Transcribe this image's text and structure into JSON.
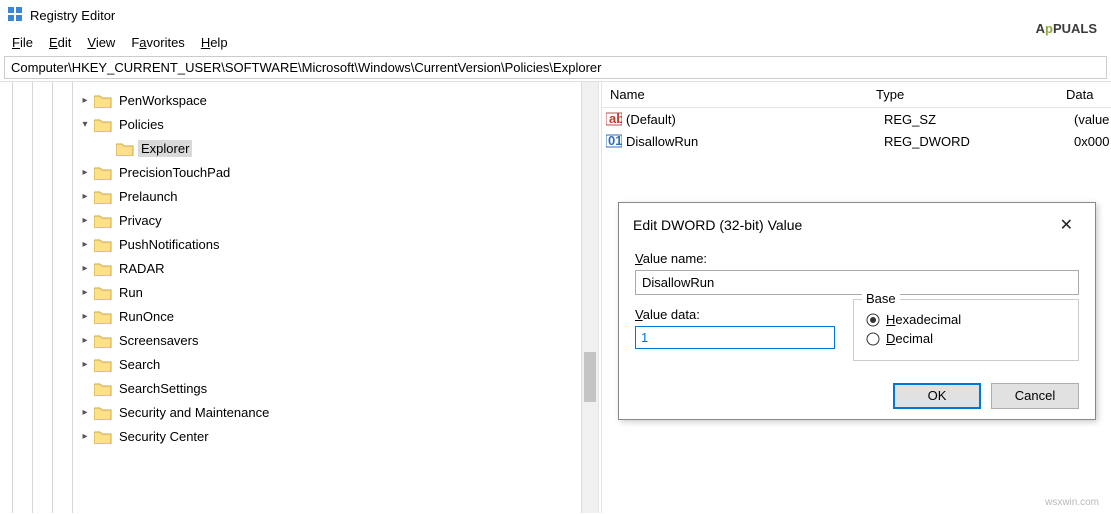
{
  "window": {
    "title": "Registry Editor"
  },
  "menus": [
    "File",
    "Edit",
    "View",
    "Favorites",
    "Help"
  ],
  "address": "Computer\\HKEY_CURRENT_USER\\SOFTWARE\\Microsoft\\Windows\\CurrentVersion\\Policies\\Explorer",
  "tree": [
    {
      "name": "PenWorkspace",
      "indent": 0,
      "toggle": "closed",
      "selected": false,
      "lead": true
    },
    {
      "name": "Policies",
      "indent": 0,
      "toggle": "open",
      "selected": false,
      "lead": true
    },
    {
      "name": "Explorer",
      "indent": 1,
      "toggle": "none",
      "selected": true,
      "lead": false
    },
    {
      "name": "PrecisionTouchPad",
      "indent": 0,
      "toggle": "closed",
      "selected": false,
      "lead": true
    },
    {
      "name": "Prelaunch",
      "indent": 0,
      "toggle": "closed",
      "selected": false,
      "lead": true
    },
    {
      "name": "Privacy",
      "indent": 0,
      "toggle": "closed",
      "selected": false,
      "lead": true
    },
    {
      "name": "PushNotifications",
      "indent": 0,
      "toggle": "closed",
      "selected": false,
      "lead": true
    },
    {
      "name": "RADAR",
      "indent": 0,
      "toggle": "closed",
      "selected": false,
      "lead": true
    },
    {
      "name": "Run",
      "indent": 0,
      "toggle": "closed",
      "selected": false,
      "lead": true
    },
    {
      "name": "RunOnce",
      "indent": 0,
      "toggle": "closed",
      "selected": false,
      "lead": true
    },
    {
      "name": "Screensavers",
      "indent": 0,
      "toggle": "closed",
      "selected": false,
      "lead": true
    },
    {
      "name": "Search",
      "indent": 0,
      "toggle": "closed",
      "selected": false,
      "lead": true
    },
    {
      "name": "SearchSettings",
      "indent": 0,
      "toggle": "none",
      "selected": false,
      "lead": true
    },
    {
      "name": "Security and Maintenance",
      "indent": 0,
      "toggle": "closed",
      "selected": false,
      "lead": true
    },
    {
      "name": "Security Center",
      "indent": 0,
      "toggle": "closed",
      "selected": false,
      "lead": true
    }
  ],
  "list": {
    "headers": {
      "name": "Name",
      "type": "Type",
      "data": "Data"
    },
    "rows": [
      {
        "icon": "string",
        "name": "(Default)",
        "type": "REG_SZ",
        "data": "(value"
      },
      {
        "icon": "dword",
        "name": "DisallowRun",
        "type": "REG_DWORD",
        "data": "0x000"
      }
    ]
  },
  "dialog": {
    "title": "Edit DWORD (32-bit) Value",
    "labels": {
      "value_name": "Value name:",
      "value_data": "Value data:",
      "base": "Base",
      "hex": "Hexadecimal",
      "dec": "Decimal",
      "ok": "OK",
      "cancel": "Cancel"
    },
    "value_name": "DisallowRun",
    "value_data": "1",
    "base_selected": "hex"
  },
  "watermark": "wsxwin.com",
  "logo": {
    "a": "A",
    "p": "p",
    "rest": "PUALS"
  }
}
